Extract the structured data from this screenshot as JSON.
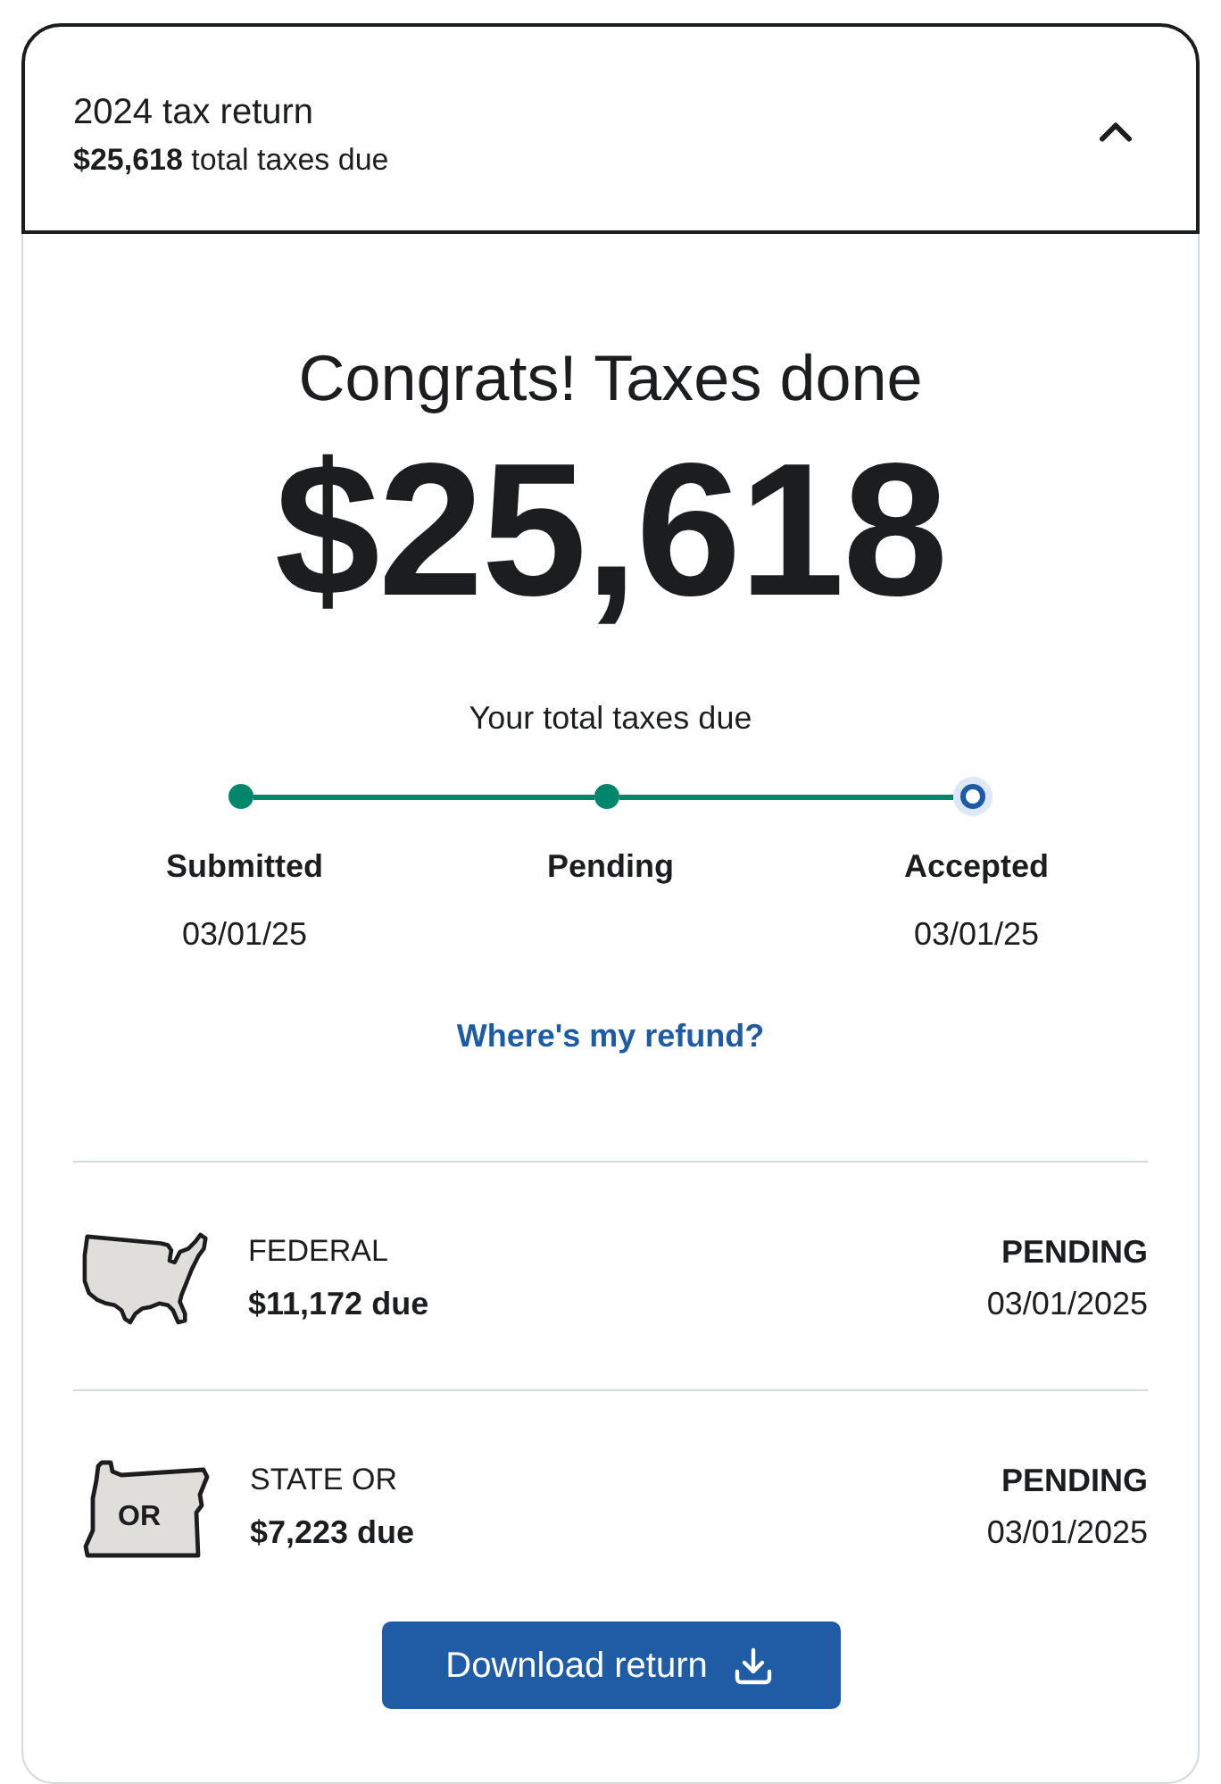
{
  "header": {
    "title": "2024 tax return",
    "subtitle": "**$25,618** total taxes due",
    "expanded": true
  },
  "hero": {
    "heading": "Congrats! Taxes done",
    "amount": "$25,618",
    "caption": "Your total taxes due"
  },
  "progress": {
    "steps": [
      {
        "kind": "done",
        "label": "Submitted",
        "date": "03/01/25"
      },
      {
        "kind": "done",
        "label": "Pending"
      },
      {
        "kind": "current",
        "label": "Accepted",
        "date": "03/01/25"
      }
    ]
  },
  "refund_link": "Where's my refund?",
  "returns": [
    {
      "kind": "federal",
      "name": "FEDERAL",
      "amount": "$11,172 due",
      "status": "PENDING",
      "date": "03/01/2025"
    },
    {
      "kind": "state",
      "name": "STATE OR",
      "badge": "OR",
      "amount": "$7,223 due",
      "status": "PENDING",
      "date": "03/01/2025"
    }
  ],
  "download_button": {
    "label": "Download return"
  }
}
